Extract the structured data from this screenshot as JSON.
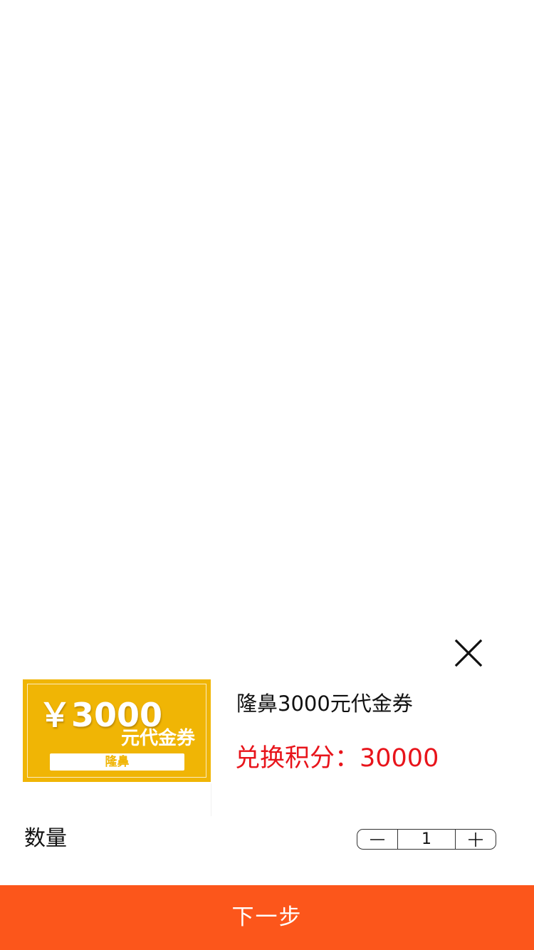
{
  "product": {
    "title": "隆鼻3000元代金券",
    "points_label": "兑换积分：30000",
    "thumbnail": {
      "amount": "￥3000",
      "subtitle": "元代金券",
      "tag": "隆鼻"
    }
  },
  "quantity": {
    "label": "数量",
    "value": "1",
    "decrement_icon": "minus-icon",
    "increment_icon": "plus-icon"
  },
  "actions": {
    "close_icon": "close-icon",
    "next_label": "下一步"
  },
  "colors": {
    "primary": "#fc561b",
    "price_red": "#e8141b",
    "voucher_gold": "#f0b505"
  }
}
